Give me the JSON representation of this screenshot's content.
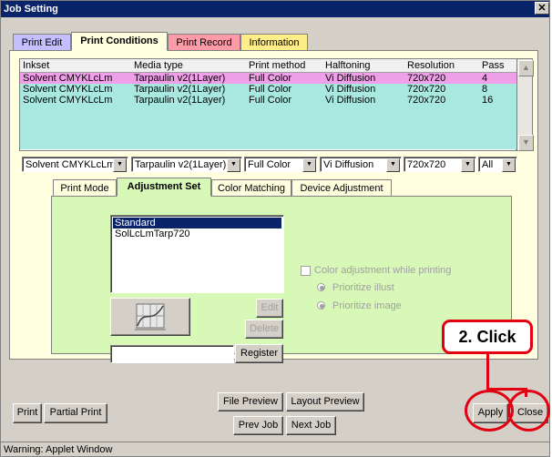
{
  "window": {
    "title": "Job Setting",
    "close_glyph": "✕"
  },
  "tabs": [
    {
      "label": "Print Edit",
      "color": "#c4c0ff"
    },
    {
      "label": "Print Conditions",
      "color": "#ffffe0"
    },
    {
      "label": "Print Record",
      "color": "#ff9aa8"
    },
    {
      "label": "Information",
      "color": "#ffee88"
    }
  ],
  "grid": {
    "columns": [
      "Inkset",
      "Media type",
      "Print method",
      "Halftoning",
      "Resolution",
      "Pass"
    ],
    "rows": [
      [
        "Solvent CMYKLcLm",
        "Tarpaulin v2(1Layer)",
        "Full Color",
        "Vi Diffusion",
        "720x720",
        "4"
      ],
      [
        "Solvent CMYKLcLm",
        "Tarpaulin v2(1Layer)",
        "Full Color",
        "Vi Diffusion",
        "720x720",
        "8"
      ],
      [
        "Solvent CMYKLcLm",
        "Tarpaulin v2(1Layer)",
        "Full Color",
        "Vi Diffusion",
        "720x720",
        "16"
      ]
    ],
    "selected_row_color": "#f0a0e8",
    "row_color": "#a8e8e0"
  },
  "selectors": [
    "Solvent CMYKLcLm",
    "Tarpaulin v2(1Layer)",
    "Full Color",
    "Vi Diffusion",
    "720x720",
    "All"
  ],
  "inner_tabs": [
    "Print Mode",
    "Adjustment Set",
    "Color Matching",
    "Device Adjustment"
  ],
  "adjustment": {
    "list_items": [
      "Standard",
      "SolLcLmTarp720"
    ],
    "selected_index": 0,
    "edit_label": "Edit",
    "delete_label": "Delete",
    "register_label": "Register",
    "register_value": "",
    "checkbox_label": "Color adjustment while printing",
    "radio_illust": "Prioritize illust",
    "radio_image": "Prioritize image"
  },
  "bottom": {
    "print": "Print",
    "partial_print": "Partial Print",
    "file_preview": "File Preview",
    "layout_preview": "Layout Preview",
    "prev_job": "Prev Job",
    "next_job": "Next Job",
    "apply": "Apply",
    "close": "Close"
  },
  "status": "Warning: Applet Window",
  "callout": {
    "text": "2. Click",
    "color": "#e40012"
  }
}
